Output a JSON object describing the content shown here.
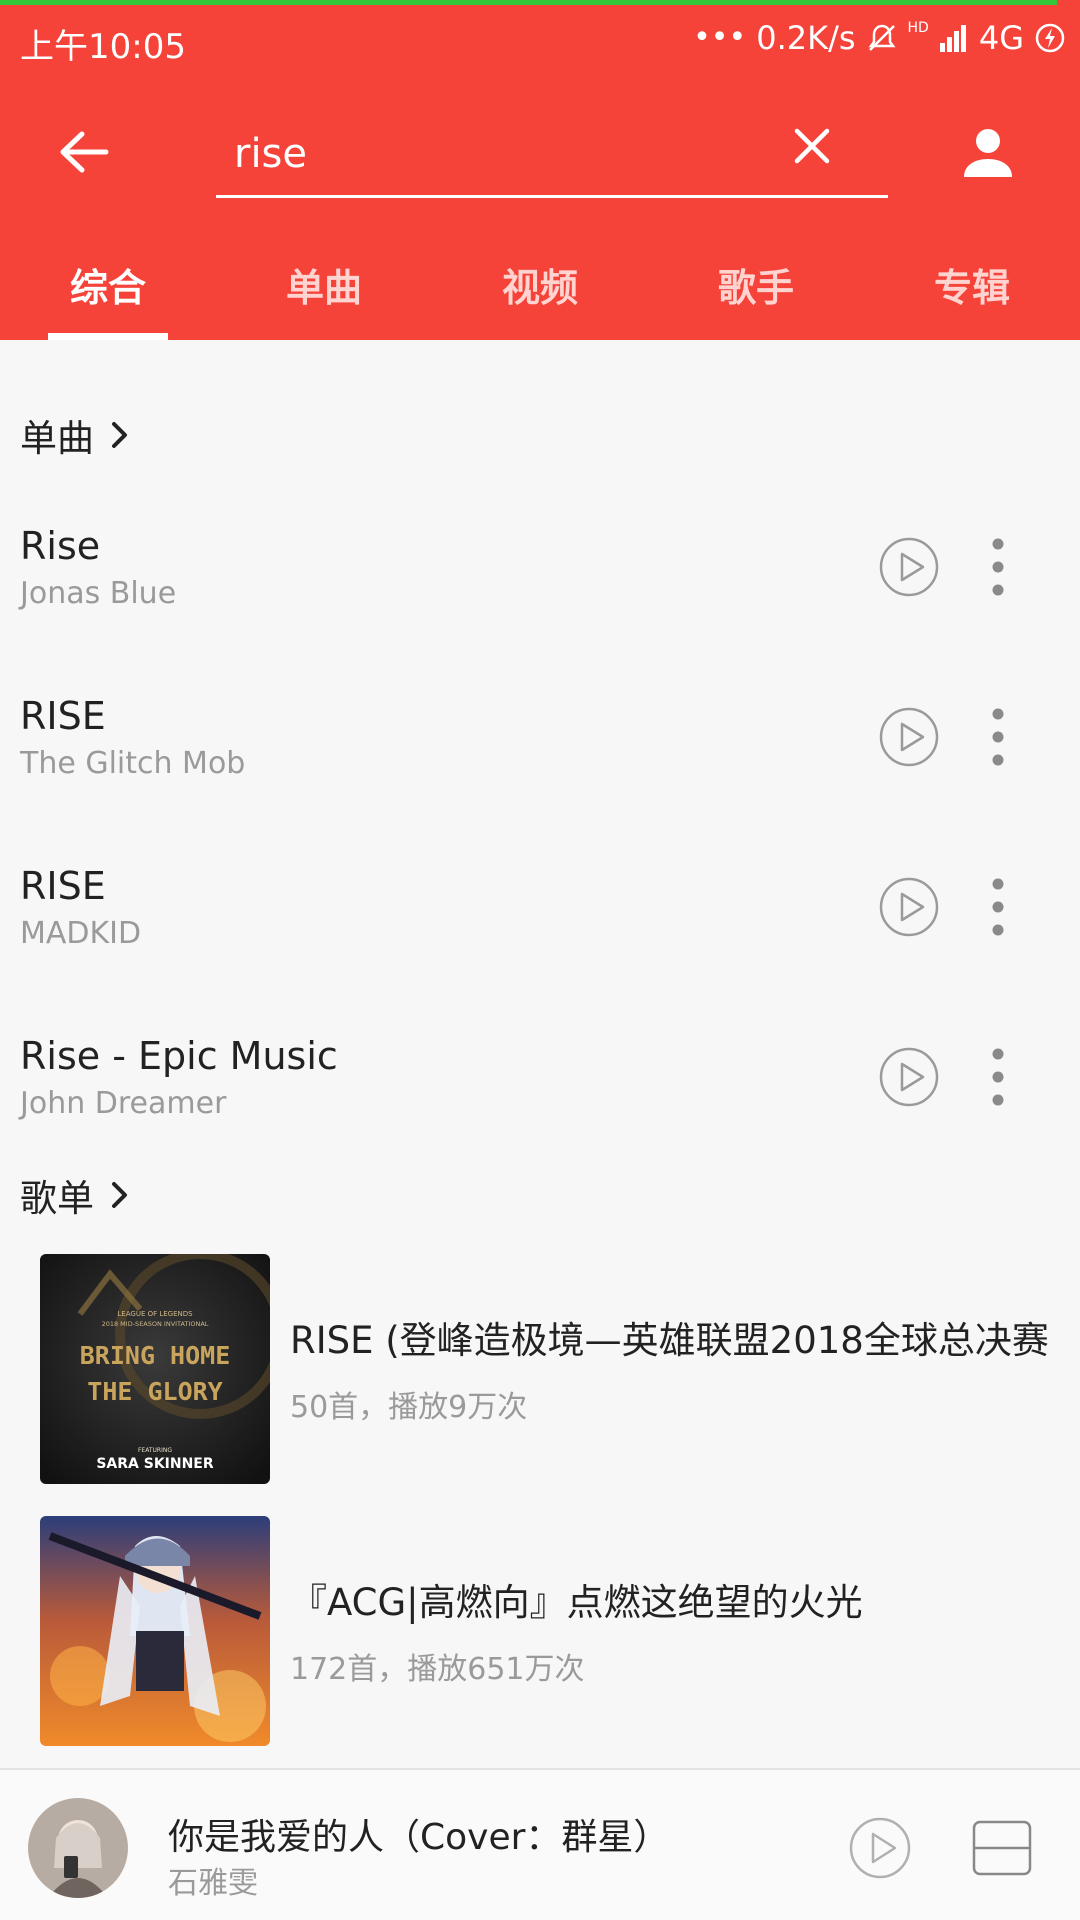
{
  "status_bar": {
    "time": "上午10:05",
    "network_speed": "0.2K/s",
    "network_type": "4G",
    "hd_label": "HD",
    "icons": [
      "dots-icon",
      "mute-bell-icon",
      "signal-icon",
      "charging-icon"
    ]
  },
  "search": {
    "query": "rise",
    "icons": [
      "back-arrow-icon",
      "clear-icon",
      "user-icon"
    ]
  },
  "tabs": [
    {
      "label": "综合",
      "active": true
    },
    {
      "label": "单曲",
      "active": false
    },
    {
      "label": "视频",
      "active": false
    },
    {
      "label": "歌手",
      "active": false
    },
    {
      "label": "专辑",
      "active": false
    }
  ],
  "songs_section": {
    "title": "单曲",
    "items": [
      {
        "title": "Rise",
        "artist": "Jonas Blue"
      },
      {
        "title": "RISE",
        "artist": "The Glitch Mob"
      },
      {
        "title": "RISE",
        "artist": "MADKID"
      },
      {
        "title": "Rise - Epic Music",
        "artist": "John Dreamer"
      }
    ]
  },
  "playlists_section": {
    "title": "歌单",
    "items": [
      {
        "title": "RISE (登峰造极境—英雄联盟2018全球总决赛",
        "meta": "50首，播放9万次",
        "cover_lines": [
          "LEAGUE OF LEGENDS",
          "2018 MID-SEASON INVITATIONAL",
          "BRING HOME",
          "THE GLORY",
          "FEATURING",
          "SARA SKINNER"
        ]
      },
      {
        "title": "『ACG|高燃向』点燃这绝望的火光",
        "meta": "172首，播放651万次"
      }
    ]
  },
  "now_playing": {
    "title": "你是我爱的人（Cover：群星）",
    "artist": "石雅雯"
  },
  "colors": {
    "header_red": "#f5433a",
    "progress_green": "#33c53a",
    "text_primary": "#222222",
    "text_secondary": "#9a9a9a"
  }
}
